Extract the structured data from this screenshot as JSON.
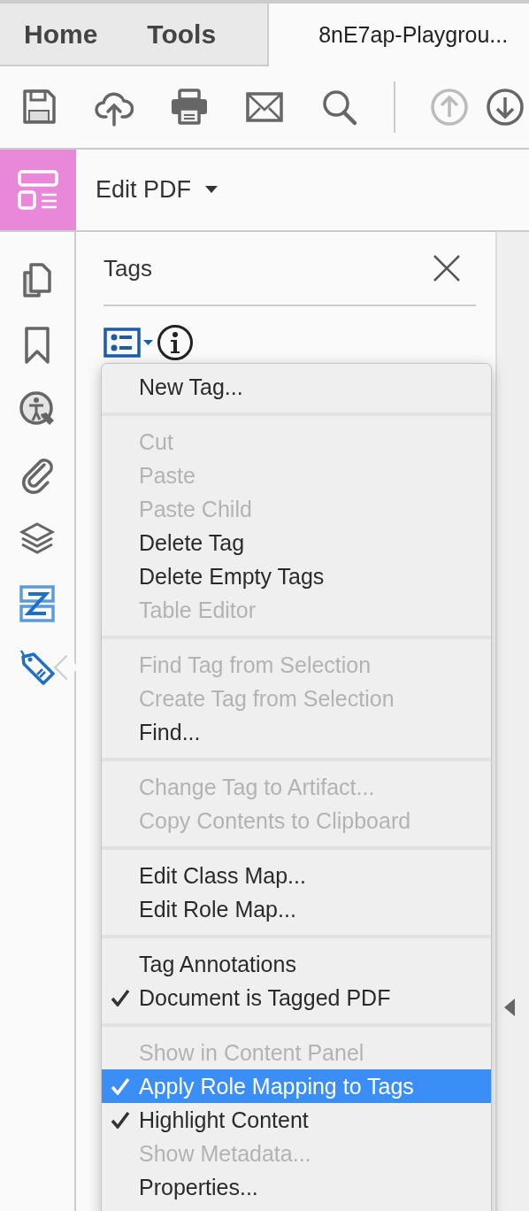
{
  "tabs": [
    {
      "label": "Home",
      "selected": false
    },
    {
      "label": "Tools",
      "selected": false
    },
    {
      "label": "8nE7ap-Playgrou...",
      "selected": true
    }
  ],
  "toolbar": {
    "buttons": [
      {
        "kind": "save",
        "disabled": false
      },
      {
        "kind": "upload",
        "disabled": false
      },
      {
        "kind": "print",
        "disabled": false
      },
      {
        "kind": "mail",
        "disabled": false
      },
      {
        "kind": "search",
        "disabled": false
      },
      {
        "kind": "up",
        "disabled": true
      },
      {
        "kind": "down",
        "disabled": false
      }
    ]
  },
  "tool_bar": {
    "title": "Edit PDF"
  },
  "sidebar": {
    "items": [
      {
        "kind": "pages",
        "selected": false
      },
      {
        "kind": "bookmark",
        "selected": false
      },
      {
        "kind": "accessibility",
        "selected": false
      },
      {
        "kind": "attachment",
        "selected": false
      },
      {
        "kind": "layers",
        "selected": false
      },
      {
        "kind": "order",
        "selected": false
      },
      {
        "kind": "tags",
        "selected": true
      }
    ]
  },
  "panel": {
    "title": "Tags"
  },
  "menu": {
    "groups": [
      {
        "items": [
          {
            "label": "New Tag...",
            "disabled": false,
            "checked": false,
            "selected": false
          }
        ]
      },
      {
        "items": [
          {
            "label": "Cut",
            "disabled": true,
            "checked": false,
            "selected": false
          },
          {
            "label": "Paste",
            "disabled": true,
            "checked": false,
            "selected": false
          },
          {
            "label": "Paste Child",
            "disabled": true,
            "checked": false,
            "selected": false
          },
          {
            "label": "Delete Tag",
            "disabled": false,
            "checked": false,
            "selected": false
          },
          {
            "label": "Delete Empty Tags",
            "disabled": false,
            "checked": false,
            "selected": false
          },
          {
            "label": "Table Editor",
            "disabled": true,
            "checked": false,
            "selected": false
          }
        ]
      },
      {
        "items": [
          {
            "label": "Find Tag from Selection",
            "disabled": true,
            "checked": false,
            "selected": false
          },
          {
            "label": "Create Tag from Selection",
            "disabled": true,
            "checked": false,
            "selected": false
          },
          {
            "label": "Find...",
            "disabled": false,
            "checked": false,
            "selected": false
          }
        ]
      },
      {
        "items": [
          {
            "label": "Change Tag to Artifact...",
            "disabled": true,
            "checked": false,
            "selected": false
          },
          {
            "label": "Copy Contents to Clipboard",
            "disabled": true,
            "checked": false,
            "selected": false
          }
        ]
      },
      {
        "items": [
          {
            "label": "Edit Class Map...",
            "disabled": false,
            "checked": false,
            "selected": false
          },
          {
            "label": "Edit Role Map...",
            "disabled": false,
            "checked": false,
            "selected": false
          }
        ]
      },
      {
        "items": [
          {
            "label": "Tag Annotations",
            "disabled": false,
            "checked": false,
            "selected": false
          },
          {
            "label": "Document is Tagged PDF",
            "disabled": false,
            "checked": true,
            "selected": false
          }
        ]
      },
      {
        "items": [
          {
            "label": "Show in Content Panel",
            "disabled": true,
            "checked": false,
            "selected": false
          },
          {
            "label": "Apply Role Mapping to Tags",
            "disabled": false,
            "checked": true,
            "selected": true
          },
          {
            "label": "Highlight Content",
            "disabled": false,
            "checked": true,
            "selected": false
          },
          {
            "label": "Show Metadata...",
            "disabled": true,
            "checked": false,
            "selected": false
          },
          {
            "label": "Properties...",
            "disabled": false,
            "checked": false,
            "selected": false
          }
        ]
      }
    ]
  }
}
